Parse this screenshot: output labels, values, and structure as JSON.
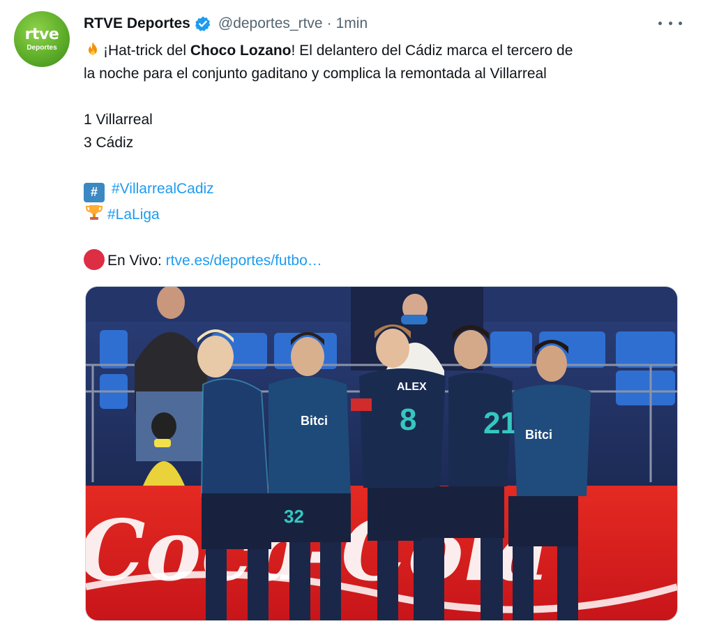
{
  "account": {
    "avatar_line1": "rtve",
    "avatar_line2": "Deportes",
    "name": "RTVE Deportes",
    "handle": "@deportes_rtve",
    "separator": "·",
    "time": "1min"
  },
  "tweet": {
    "line1_pre": "¡Hat-trick del ",
    "line1_bold": "Choco Lozano",
    "line1_post": "! El delantero del Cádiz marca el tercero de",
    "line2": "la noche para el conjunto gaditano y complica la remontada al Villarreal",
    "score1": "1 Villarreal",
    "score2": "3 Cádiz",
    "hashtag1_symbol": "#",
    "hashtag1": "#VillarrealCadiz",
    "hashtag2": "#LaLiga",
    "live_label": "En Vivo: ",
    "live_link": "rtve.es/deportes/futbo…"
  },
  "media": {
    "shirt_numbers": [
      "32",
      "8",
      "21"
    ],
    "shirt_name": "ALEX",
    "sponsor": "Bitci",
    "ad_board": "Coca-Cola"
  },
  "colors": {
    "link": "#1d9bf0",
    "verified": "#1d9bf0",
    "avatar_green": "#5fae2a",
    "kit_navy": "#1d2b4f",
    "kit_teal": "#35c7c0",
    "ad_red": "#e02020"
  },
  "icons": [
    "verified-badge-icon",
    "more-options-icon",
    "fire-emoji-icon",
    "hashtag-emoji-icon",
    "trophy-emoji-icon",
    "red-circle-emoji-icon"
  ]
}
